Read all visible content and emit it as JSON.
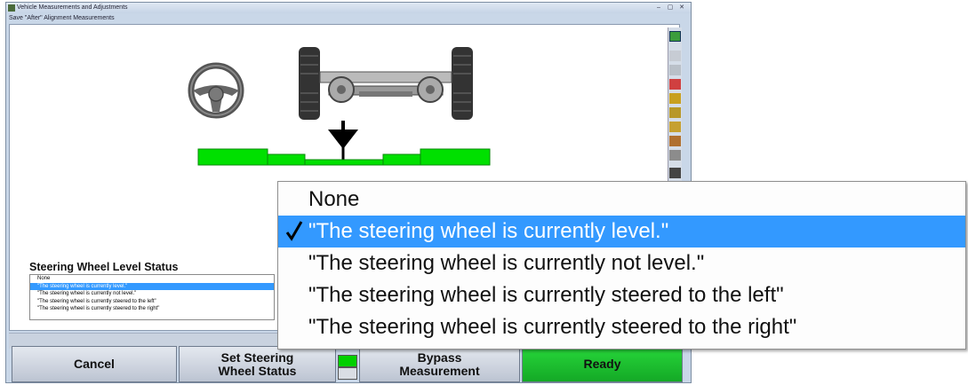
{
  "window": {
    "title": "Vehicle Measurements and Adjustments",
    "subtitle": "Save \"After\" Alignment Measurements"
  },
  "steering": {
    "label": "Steering Wheel Level Status",
    "options": [
      "None",
      "\"The steering wheel is currently level.\"",
      "\"The steering wheel is currently not level.\"",
      "\"The steering wheel is currently steered to the left\"",
      "\"The steering wheel is currently steered to the right\""
    ],
    "selected_index": 1
  },
  "buttons": {
    "cancel": "Cancel",
    "set_status": "Set Steering\nWheel Status",
    "bypass": "Bypass\nMeasurement",
    "ready": "Ready"
  },
  "colors": {
    "level_bar": "#00e000",
    "selection": "#3399ff",
    "ready_button": "#1fc030"
  },
  "icons": [
    "steering-wheel-icon",
    "axle-icon",
    "level-indicator-icon",
    "help-icon",
    "toolbar-icons"
  ]
}
